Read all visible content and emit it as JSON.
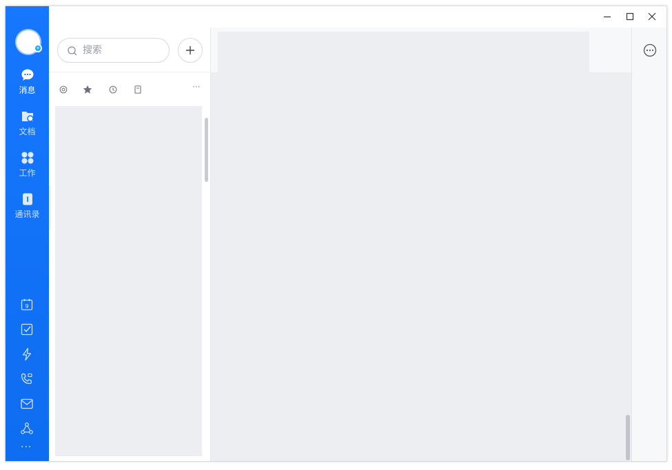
{
  "sidebar": {
    "items": [
      {
        "label": "消息",
        "icon": "chat-bubble-icon",
        "active": true
      },
      {
        "label": "文档",
        "icon": "docs-icon",
        "active": false
      },
      {
        "label": "工作",
        "icon": "apps-icon",
        "active": false
      },
      {
        "label": "通讯录",
        "icon": "contacts-icon",
        "active": false
      }
    ],
    "tools": [
      "calendar-icon",
      "todo-icon",
      "flash-icon",
      "call-icon",
      "mail-icon",
      "network-icon"
    ],
    "calendar_day": "9",
    "more": "···"
  },
  "search": {
    "placeholder": "搜索",
    "value": ""
  },
  "filters": [
    "mention-icon",
    "star-icon",
    "clock-icon",
    "note-icon"
  ],
  "filters_more": "···",
  "colors": {
    "brand": "#1677ff",
    "panel": "#eceef1",
    "side": "#f7f8fa"
  }
}
